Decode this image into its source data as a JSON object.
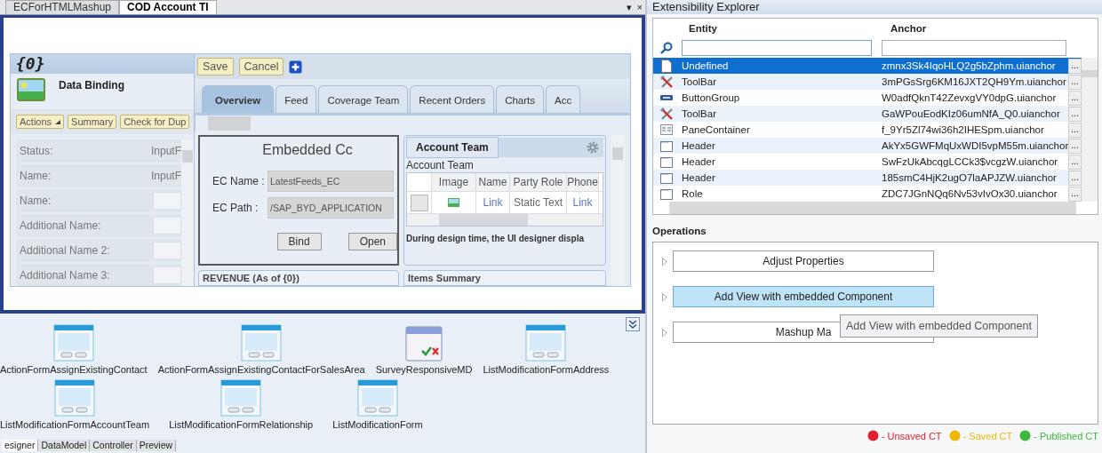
{
  "doc_tabs": [
    {
      "label": "ECForHTMLMashup",
      "selected": false
    },
    {
      "label": "COD Account TI",
      "selected": true
    }
  ],
  "tab_controls": [
    "▾",
    "×"
  ],
  "form_header": {
    "title": "{0}",
    "subtitle": "Data Binding"
  },
  "form_actions": [
    {
      "label": "Actions",
      "kind": "menu"
    },
    {
      "label": "Summary",
      "kind": "plain"
    },
    {
      "label": "Check for Dup",
      "kind": "plain"
    }
  ],
  "form_fields": [
    {
      "label": "Status:",
      "kind": "text",
      "value": "InputF"
    },
    {
      "label": "Name:",
      "kind": "text",
      "value": "InputF"
    },
    {
      "label": "Name:",
      "kind": "input"
    },
    {
      "label": "Additional Name:",
      "kind": "input"
    },
    {
      "label": "Additional Name 2:",
      "kind": "input"
    },
    {
      "label": "Additional Name 3:",
      "kind": "input"
    }
  ],
  "toolbar": [
    "Save",
    "Cancel"
  ],
  "view_tabs": [
    {
      "label": "Overview",
      "selected": true
    },
    {
      "label": "Feed",
      "selected": false
    },
    {
      "label": "Coverage Team",
      "selected": false
    },
    {
      "label": "Recent Orders",
      "selected": false
    },
    {
      "label": "Charts",
      "selected": false
    },
    {
      "label": "Acc",
      "selected": false
    }
  ],
  "embedded": {
    "title": "Embedded Cc",
    "fields": [
      {
        "label": "EC Name :",
        "value": "LatestFeeds_EC"
      },
      {
        "label": "EC Path :",
        "value": "/SAP_BYD_APPLICATION"
      }
    ],
    "buttons": [
      "Bind",
      "Open"
    ]
  },
  "account_team": {
    "tab": "Account Team",
    "caption": "Account Team",
    "columns": [
      "Image",
      "Name",
      "Party Role",
      "Phone"
    ],
    "row": [
      "Link",
      "Static Text",
      "Link"
    ],
    "note": "During design time, the UI designer displa"
  },
  "lower_panels": [
    "REVENUE (As of {0})",
    "Items Summary"
  ],
  "gallery": [
    [
      {
        "label": "ActionFormAssignExistingContact",
        "kind": "form"
      },
      {
        "label": "ActionFormAssignExistingContactForSalesArea",
        "kind": "form"
      },
      {
        "label": "SurveyResponsiveMD",
        "kind": "survey"
      },
      {
        "label": "ListModificationFormAddress",
        "kind": "form"
      }
    ],
    [
      {
        "label": "ListModificationFormAccountTeam",
        "kind": "form"
      },
      {
        "label": "ListModificationFormRelationship",
        "kind": "form"
      },
      {
        "label": "ListModificationForm",
        "kind": "form"
      }
    ]
  ],
  "bottom_tabs": [
    {
      "label": "esigner",
      "selected": true
    },
    {
      "label": "DataModel",
      "selected": false
    },
    {
      "label": "Controller",
      "selected": false
    },
    {
      "label": "Preview",
      "selected": false
    }
  ],
  "explorer": {
    "title": "Extensibility Explorer",
    "columns": [
      "Entity",
      "Anchor"
    ],
    "rows": [
      {
        "entity": "Undefined",
        "anchor": "zmnx3Sk4IqoHLQ2g5bZphm.uianchor",
        "button": "...",
        "kind": "page",
        "selected": true
      },
      {
        "entity": "ToolBar",
        "anchor": "3mPGsSrg6KM16JXT2QH9Ym.uianchor",
        "button": "...",
        "kind": "tools",
        "selected": false
      },
      {
        "entity": "ButtonGroup",
        "anchor": "W0adfQknT42ZevxgVY0dpG.uianchor",
        "button": "...",
        "kind": "buttons",
        "selected": false
      },
      {
        "entity": "ToolBar",
        "anchor": "GaWPouEodKIz06umNfA_Q0.uianchor",
        "button": "...",
        "kind": "tools",
        "selected": false
      },
      {
        "entity": "PaneContainer",
        "anchor": "f_9Yr5Zl74wi36h2IHESpm.uianchor",
        "button": "...",
        "kind": "pane",
        "selected": false
      },
      {
        "entity": "Header",
        "anchor": "AkYx5GWFMqUxWDI5vpM55m.uianchor",
        "button": "...",
        "kind": "header",
        "selected": false
      },
      {
        "entity": "Header",
        "anchor": "SwFzUkAbcqgLCCk3$vcgzW.uianchor",
        "button": "...",
        "kind": "header",
        "selected": false
      },
      {
        "entity": "Header",
        "anchor": "185smC4HjK2ugO7laAPJZW.uianchor",
        "button": "...",
        "kind": "header",
        "selected": false
      },
      {
        "entity": "Role",
        "anchor": "ZDC7JGnNQq6Nv53vIvOx30.uianchor",
        "button": "...",
        "kind": "header",
        "selected": false
      }
    ]
  },
  "operations": {
    "title": "Operations",
    "items": [
      {
        "label": "Adjust Properties",
        "selected": false
      },
      {
        "label": "Add View with embedded Component",
        "selected": true
      },
      {
        "label": "Mashup Ma",
        "selected": false
      }
    ],
    "tooltip": "Add View with embedded Component"
  },
  "legend": [
    {
      "label": "- Unsaved CT",
      "color": "#e0202c"
    },
    {
      "label": "- Saved CT",
      "color": "#f0b800"
    },
    {
      "label": "- Published CT",
      "color": "#3cb83c"
    }
  ]
}
